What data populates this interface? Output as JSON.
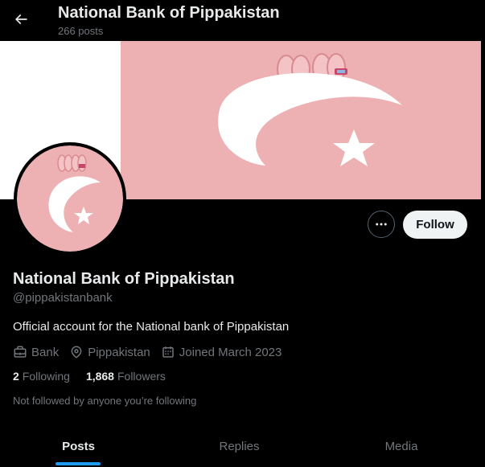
{
  "header": {
    "title": "National Bank of Pippakistan",
    "post_count": "266 posts"
  },
  "profile": {
    "display_name": "National Bank of Pippakistan",
    "handle": "@pippakistanbank",
    "bio": "Official account for the National bank of Pippakistan",
    "category": "Bank",
    "location": "Pippakistan",
    "joined": "Joined March 2023",
    "following_count": "2",
    "following_label": "Following",
    "followers_count": "1,868",
    "followers_label": "Followers",
    "not_followed_text": "Not followed by anyone you’re following"
  },
  "actions": {
    "follow_label": "Follow"
  },
  "tabs": [
    {
      "label": "Posts",
      "active": true
    },
    {
      "label": "Replies",
      "active": false
    },
    {
      "label": "Media",
      "active": false
    }
  ],
  "colors": {
    "accent": "#1d9bf0",
    "banner_pink": "#edb1b4",
    "background": "#000000"
  }
}
